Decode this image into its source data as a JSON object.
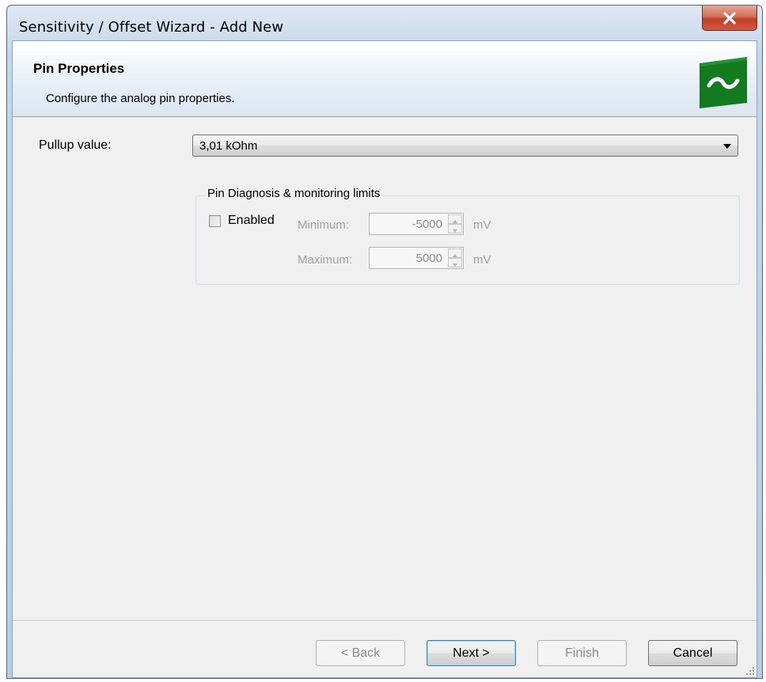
{
  "window": {
    "title": "Sensitivity / Offset Wizard - Add New"
  },
  "header": {
    "title": "Pin Properties",
    "subtitle": "Configure the analog pin properties.",
    "logo_symbol": "~"
  },
  "pullup": {
    "label": "Pullup value:",
    "value": "3,01 kOhm"
  },
  "diagnosis": {
    "group_title": "Pin Diagnosis & monitoring limits",
    "enabled_label": "Enabled",
    "enabled_checked": false,
    "minimum": {
      "label": "Minimum:",
      "value": "-5000",
      "unit": "mV"
    },
    "maximum": {
      "label": "Maximum:",
      "value": "5000",
      "unit": "mV"
    }
  },
  "buttons": {
    "back": "< Back",
    "next": "Next >",
    "finish": "Finish",
    "cancel": "Cancel"
  },
  "colors": {
    "accent_green": "#137a1f",
    "title_bar": "#c6d6ea",
    "close_red": "#c0402a"
  }
}
